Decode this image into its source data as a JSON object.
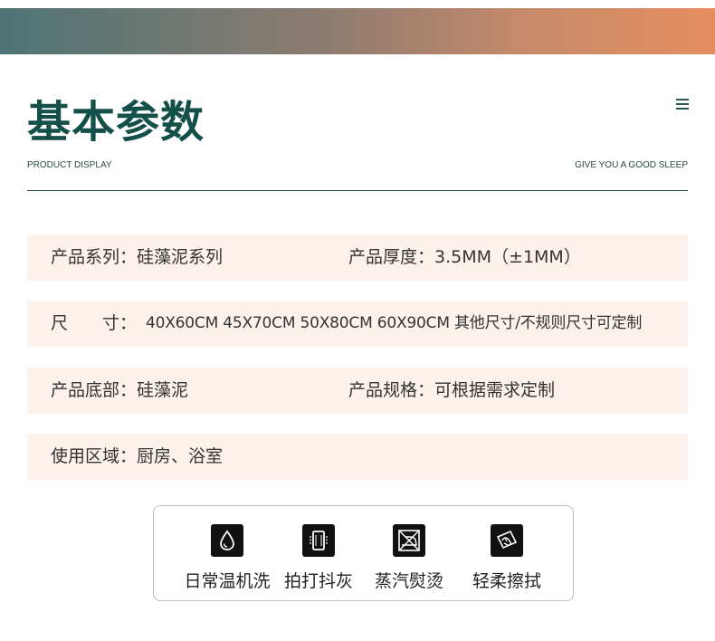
{
  "header": {
    "title": "基本参数",
    "subtitle_left": "PRODUCT DISPLAY",
    "subtitle_right": "GIVE YOU A GOOD SLEEP"
  },
  "params": {
    "series_label": "产品系列：",
    "series_value": "硅藻泥系列",
    "thickness_label": "产品厚度：",
    "thickness_value": "3.5MM（±1MM）",
    "size_label": "尺　　寸：",
    "size_value": "40X60CM  45X70CM  50X80CM  60X90CM  其他尺寸/不规则尺寸可定制",
    "base_label": "产品底部：",
    "base_value": "硅藻泥",
    "spec_label": "产品规格：",
    "spec_value": "可根据需求定制",
    "usage_label": "使用区域：",
    "usage_value": "厨房、浴室"
  },
  "care": [
    {
      "label": "日常温机洗",
      "icon": "water-drop-icon"
    },
    {
      "label": "拍打抖灰",
      "icon": "pat-dust-icon"
    },
    {
      "label": "蒸汽熨烫",
      "icon": "no-ironing-icon"
    },
    {
      "label": "轻柔擦拭",
      "icon": "gentle-wipe-icon"
    }
  ]
}
